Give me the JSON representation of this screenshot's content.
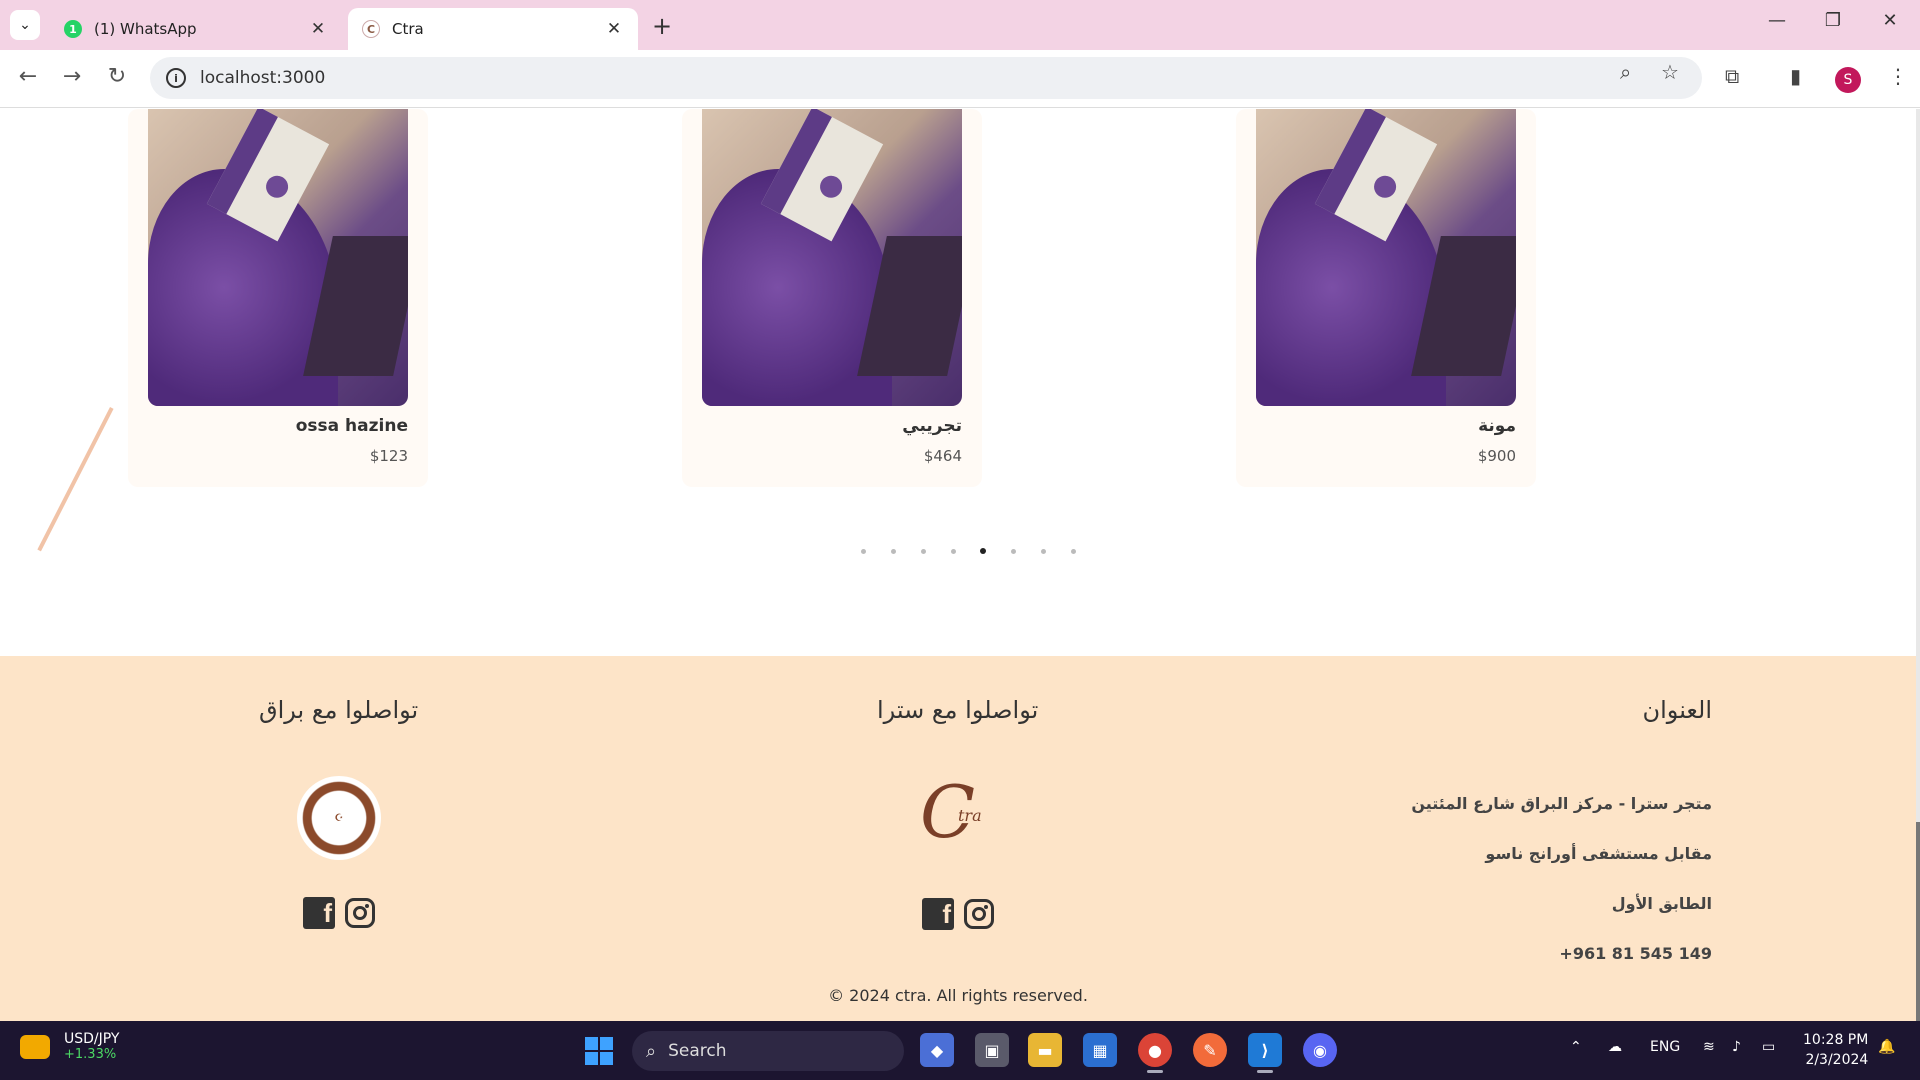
{
  "browser": {
    "tabs": [
      {
        "title": "(1) WhatsApp",
        "favicon": "whatsapp-icon",
        "badge": "1"
      },
      {
        "title": "Ctra",
        "favicon": "ctra-icon"
      }
    ],
    "url": "localhost:3000",
    "profile_initial": "S"
  },
  "products": [
    {
      "name": "ossa hazine",
      "price": "$123"
    },
    {
      "name": "تجريبي",
      "price": "$464"
    },
    {
      "name": "مونة",
      "price": "$900"
    }
  ],
  "carousel": {
    "dot_count": 8,
    "active_index": 4
  },
  "footer": {
    "address_title": "العنوان",
    "address_lines": [
      "متجر سترا - مركز البراق شارع المئتين",
      "مقابل مستشفى أورانج ناسو",
      "الطابق الأول",
      "+961 81 545 149"
    ],
    "ctra_title": "تواصلوا مع سترا",
    "buraq_title": "تواصلوا مع براق",
    "ctra_logo_text": "C",
    "ctra_logo_sub": "tra",
    "copyright": "© 2024 ctra. All rights reserved."
  },
  "taskbar": {
    "ticker_symbol": "USD/JPY",
    "ticker_change": "+1.33%",
    "search_label": "Search",
    "language": "ENG",
    "time": "10:28 PM",
    "date": "2/3/2024"
  }
}
